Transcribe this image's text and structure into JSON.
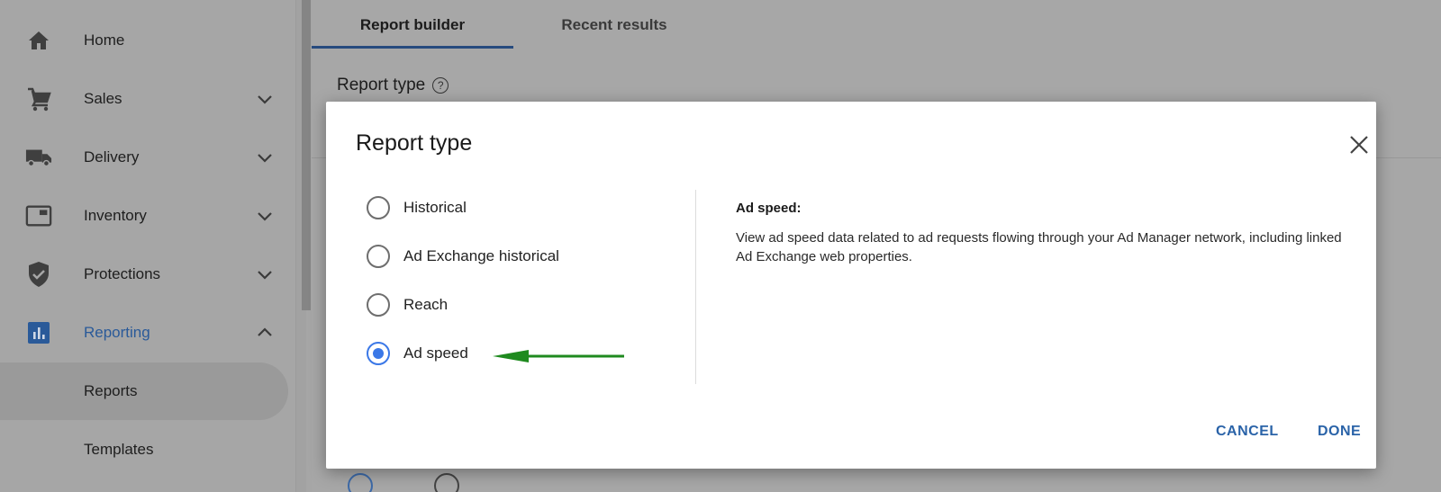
{
  "sidebar": {
    "items": [
      {
        "label": "Home",
        "icon": "home-icon",
        "expandable": false
      },
      {
        "label": "Sales",
        "icon": "cart-icon",
        "expandable": true,
        "expanded": false
      },
      {
        "label": "Delivery",
        "icon": "truck-icon",
        "expandable": true,
        "expanded": false
      },
      {
        "label": "Inventory",
        "icon": "inventory-icon",
        "expandable": true,
        "expanded": false
      },
      {
        "label": "Protections",
        "icon": "shield-check-icon",
        "expandable": true,
        "expanded": false
      },
      {
        "label": "Reporting",
        "icon": "bar-chart-icon",
        "expandable": true,
        "expanded": true,
        "active": true
      }
    ],
    "sub_items": [
      {
        "label": "Reports",
        "selected": true
      },
      {
        "label": "Templates",
        "selected": false
      }
    ]
  },
  "main": {
    "tabs": [
      {
        "label": "Report builder",
        "active": true
      },
      {
        "label": "Recent results",
        "active": false
      }
    ],
    "section_label": "Report type",
    "help_icon": "?"
  },
  "dialog": {
    "title": "Report type",
    "close_icon": "close-icon",
    "options": [
      {
        "label": "Historical",
        "checked": false
      },
      {
        "label": "Ad Exchange historical",
        "checked": false
      },
      {
        "label": "Reach",
        "checked": false
      },
      {
        "label": "Ad speed",
        "checked": true
      }
    ],
    "description": {
      "title": "Ad speed:",
      "text": "View ad speed data related to ad requests flowing through your Ad Manager network, including linked Ad Exchange web properties."
    },
    "buttons": {
      "cancel": "CANCEL",
      "done": "DONE"
    },
    "annotation_color": "#1f8a1f"
  },
  "colors": {
    "accent": "#3b78e7",
    "link": "#2a63a8",
    "active_nav": "#2a5a99"
  }
}
